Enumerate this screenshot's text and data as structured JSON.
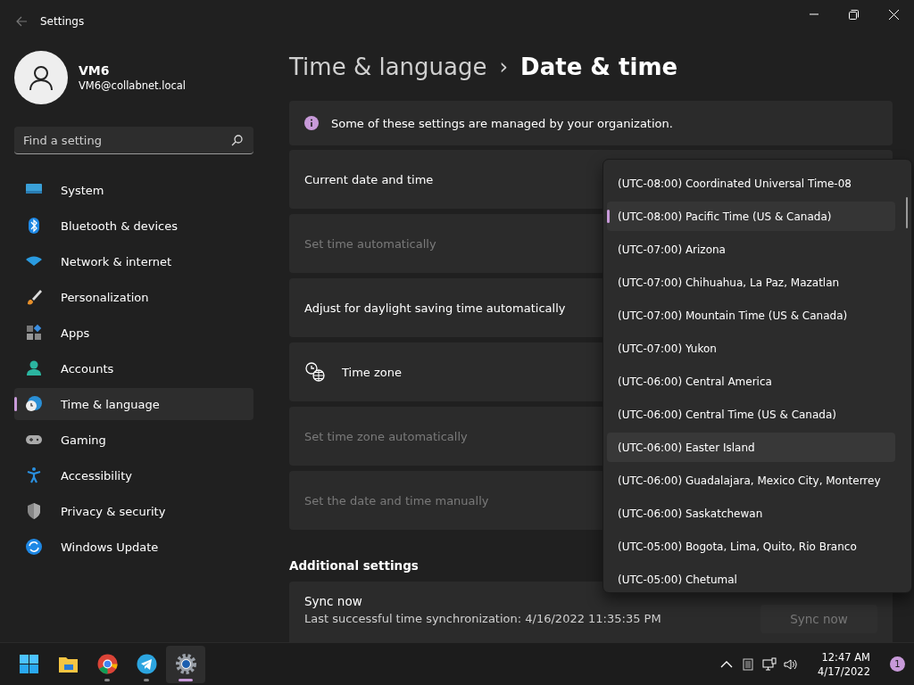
{
  "window": {
    "title": "Settings"
  },
  "profile": {
    "name": "VM6",
    "email": "VM6@collabnet.local"
  },
  "search": {
    "placeholder": "Find a setting"
  },
  "nav": [
    {
      "label": "System",
      "selected": false
    },
    {
      "label": "Bluetooth & devices",
      "selected": false
    },
    {
      "label": "Network & internet",
      "selected": false
    },
    {
      "label": "Personalization",
      "selected": false
    },
    {
      "label": "Apps",
      "selected": false
    },
    {
      "label": "Accounts",
      "selected": false
    },
    {
      "label": "Time & language",
      "selected": true
    },
    {
      "label": "Gaming",
      "selected": false
    },
    {
      "label": "Accessibility",
      "selected": false
    },
    {
      "label": "Privacy & security",
      "selected": false
    },
    {
      "label": "Windows Update",
      "selected": false
    }
  ],
  "breadcrumb": {
    "parent": "Time & language",
    "separator": "›",
    "current": "Date & time"
  },
  "banner": {
    "text": "Some of these settings are managed by your organization."
  },
  "settings": [
    {
      "label": "Current date and time",
      "disabled": false,
      "kind": "plain"
    },
    {
      "label": "Set time automatically",
      "disabled": true,
      "kind": "plain"
    },
    {
      "label": "Adjust for daylight saving time automatically",
      "disabled": false,
      "kind": "plain"
    },
    {
      "label": "Time zone",
      "disabled": false,
      "kind": "icon"
    },
    {
      "label": "Set time zone automatically",
      "disabled": true,
      "kind": "plain"
    },
    {
      "label": "Set the date and time manually",
      "disabled": true,
      "kind": "plain"
    }
  ],
  "timezone_dropdown": [
    {
      "label": "(UTC-08:00) Coordinated Universal Time-08",
      "selected": false,
      "hovered": false
    },
    {
      "label": "(UTC-08:00) Pacific Time (US & Canada)",
      "selected": true,
      "hovered": false
    },
    {
      "label": "(UTC-07:00) Arizona",
      "selected": false,
      "hovered": false
    },
    {
      "label": "(UTC-07:00) Chihuahua, La Paz, Mazatlan",
      "selected": false,
      "hovered": false
    },
    {
      "label": "(UTC-07:00) Mountain Time (US & Canada)",
      "selected": false,
      "hovered": false
    },
    {
      "label": "(UTC-07:00) Yukon",
      "selected": false,
      "hovered": false
    },
    {
      "label": "(UTC-06:00) Central America",
      "selected": false,
      "hovered": false
    },
    {
      "label": "(UTC-06:00) Central Time (US & Canada)",
      "selected": false,
      "hovered": false
    },
    {
      "label": "(UTC-06:00) Easter Island",
      "selected": false,
      "hovered": true
    },
    {
      "label": "(UTC-06:00) Guadalajara, Mexico City, Monterrey",
      "selected": false,
      "hovered": false
    },
    {
      "label": "(UTC-06:00) Saskatchewan",
      "selected": false,
      "hovered": false
    },
    {
      "label": "(UTC-05:00) Bogota, Lima, Quito, Rio Branco",
      "selected": false,
      "hovered": false
    },
    {
      "label": "(UTC-05:00) Chetumal",
      "selected": false,
      "hovered": false
    }
  ],
  "additional": {
    "heading": "Additional settings",
    "sync": {
      "title": "Sync now",
      "last_sync": "Last successful time synchronization: 4/16/2022 11:35:35 PM",
      "button": "Sync now",
      "disabled": true
    }
  },
  "taskbar": {
    "apps": [
      {
        "running": false,
        "active": false
      },
      {
        "running": false,
        "active": false
      },
      {
        "running": true,
        "active": false
      },
      {
        "running": true,
        "active": false
      },
      {
        "running": true,
        "active": true
      }
    ],
    "time": "12:47 AM",
    "date": "4/17/2022",
    "notifications": "1"
  }
}
